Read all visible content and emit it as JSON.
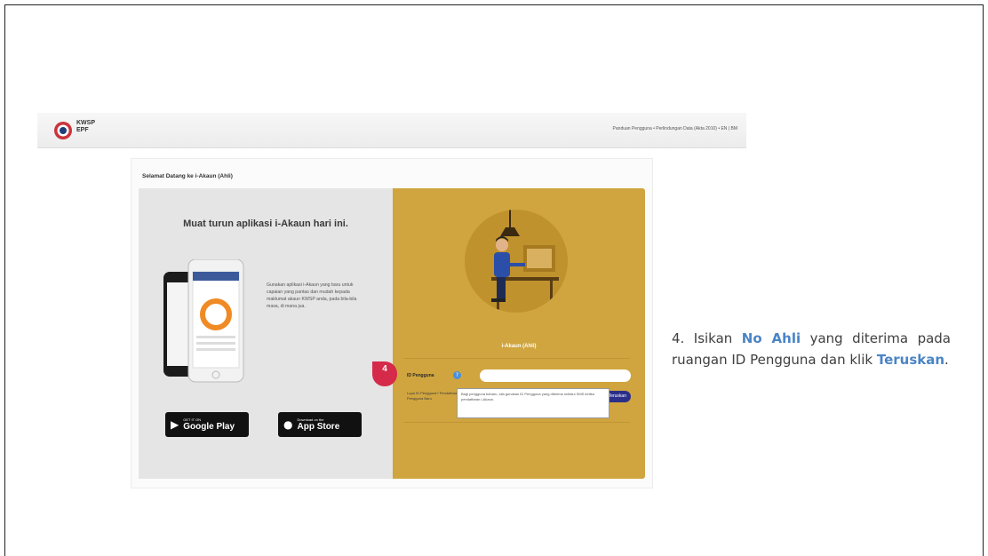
{
  "header": {
    "logo_line1": "KWSP",
    "logo_line2": "EPF",
    "links": "Panduan Pengguna • Perlindungan Data (Akta 2010) • EN | BM"
  },
  "card": {
    "title": "Selamat Datang ke i-Akaun (Ahli)"
  },
  "promo": {
    "title": "Muat turun aplikasi i-Akaun hari ini.",
    "text": "Gunakan aplikasi i-Akaun yang baru untuk capaian yang pantas dan mudah kepada maklumat akaun KWSP anda, pada bila-bila masa, di mana jua.",
    "google_play_small": "GET IT ON",
    "google_play_big": "Google Play",
    "app_store_small": "Download on the",
    "app_store_big": "App Store"
  },
  "login": {
    "title": "i-Akaun (Ahli)",
    "id_label": "ID Pengguna",
    "id_value": "",
    "small_text": "Lupa ID Pengguna? Pendaftaran Pengguna Baru",
    "tooltip": "Bagi pengguna baharu, sila gunakan ID Pengguna yang diterima melalui SMS ketika pendaftaran i-Akaun.",
    "next_label": "Teruskan"
  },
  "step": {
    "number": "4"
  },
  "instruction": {
    "prefix": "4. Isikan ",
    "highlight1": "No Ahli",
    "middle": " yang diterima pada ruangan ID Pengguna dan klik ",
    "highlight2": "Teruskan",
    "suffix": "."
  },
  "colors": {
    "gold_panel": "#d0a53f",
    "gray_panel": "#e5e5e5",
    "highlight": "#4a84c6",
    "marker": "#d62a4a",
    "button": "#2b2f8a"
  }
}
